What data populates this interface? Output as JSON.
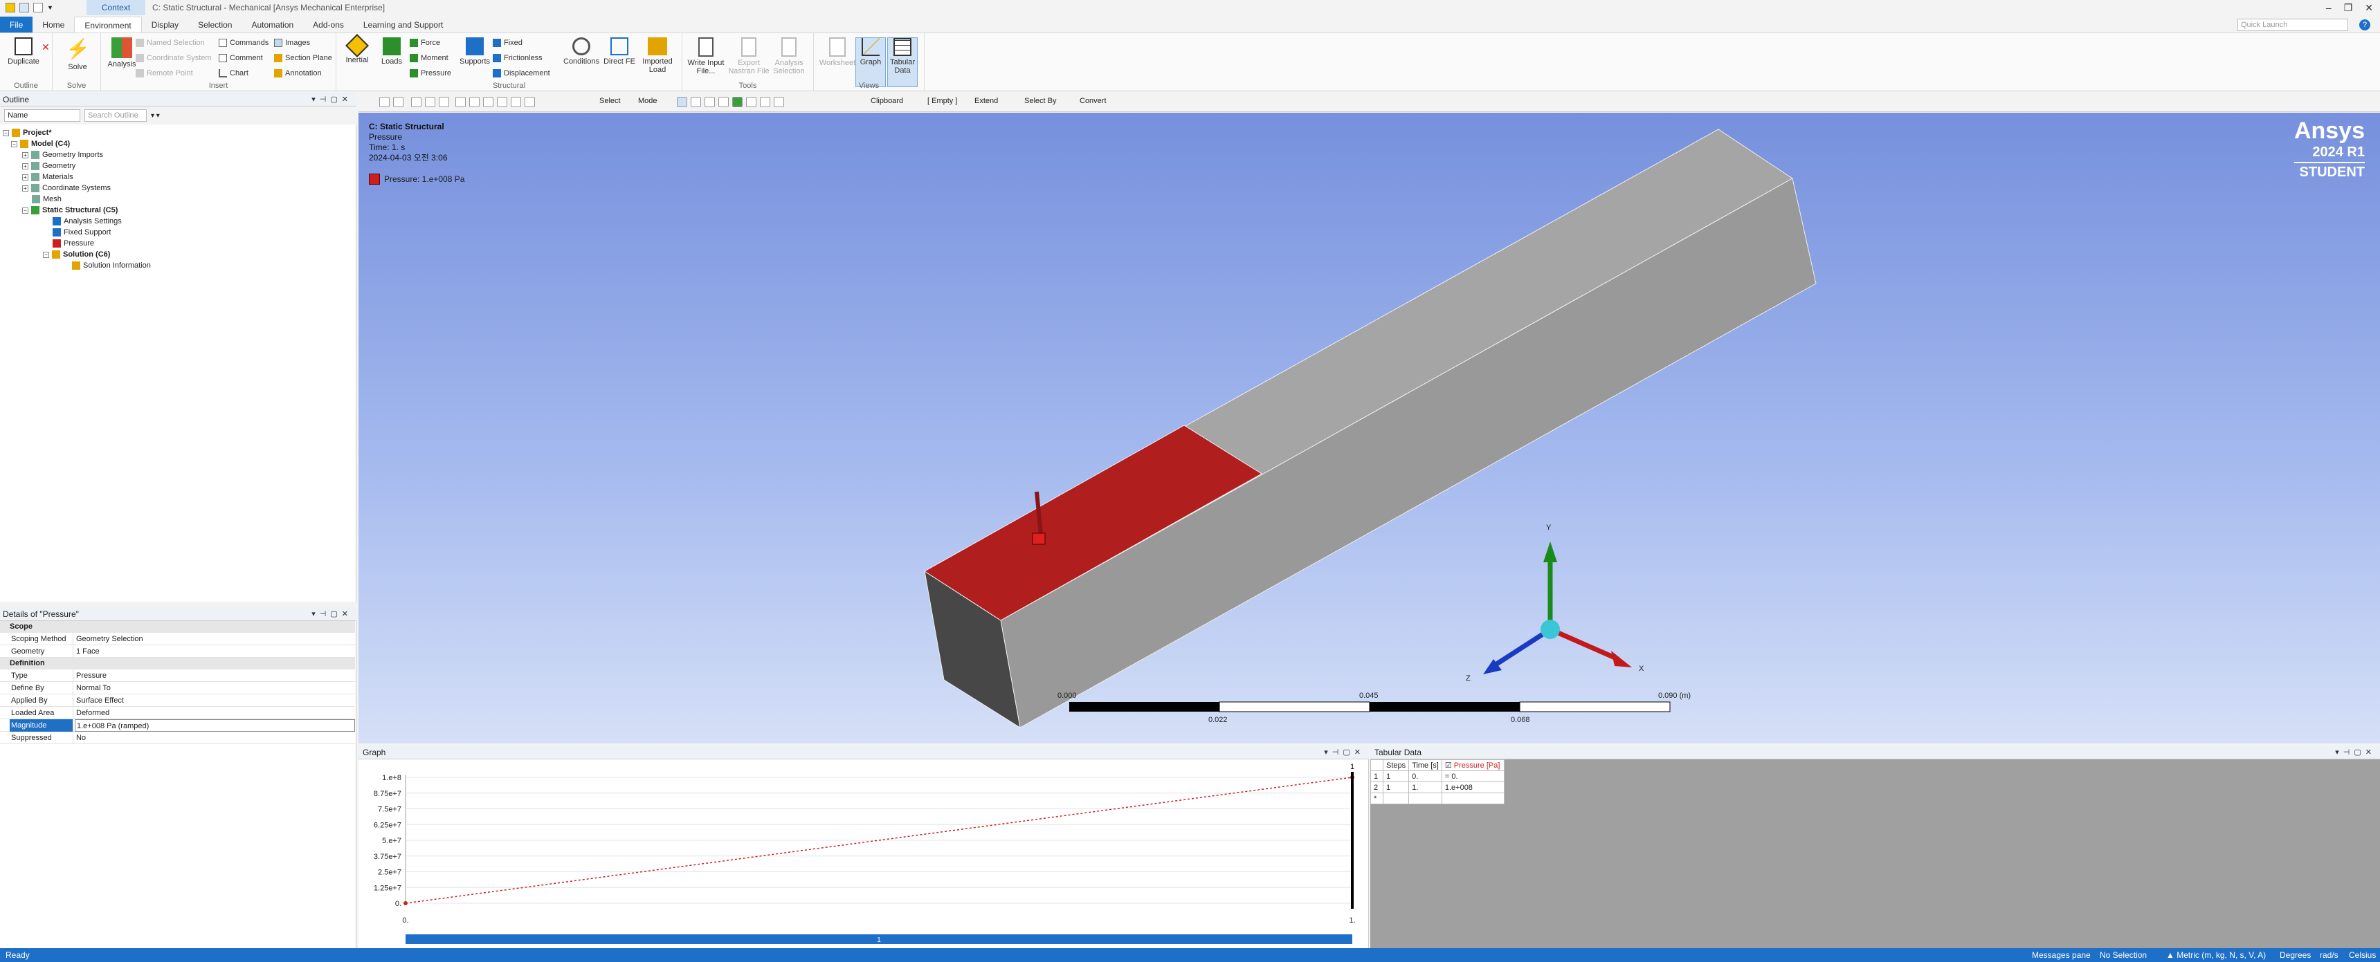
{
  "titlebar": {
    "context_tab": "Context",
    "doc_title": "C: Static Structural - Mechanical [Ansys Mechanical Enterprise]",
    "min": "–",
    "restore": "❐",
    "close": "✕"
  },
  "menu": {
    "tabs": [
      "File",
      "Home",
      "Environment",
      "Display",
      "Selection",
      "Automation",
      "Add-ons",
      "Learning and Support"
    ],
    "quick_launch_placeholder": "Quick Launch"
  },
  "ribbon": {
    "outline_group": {
      "duplicate": "Duplicate",
      "label": "Outline"
    },
    "solve_group": {
      "solve": "Solve",
      "label": "Solve"
    },
    "insert_group": {
      "analysis": "Analysis",
      "named_selection": "Named Selection",
      "coordinate_system": "Coordinate System",
      "remote_point": "Remote Point",
      "commands": "Commands",
      "comment": "Comment",
      "chart": "Chart",
      "images": "Images",
      "section_plane": "Section Plane",
      "annotation": "Annotation",
      "label": "Insert"
    },
    "structural_group": {
      "inertial": "Inertial",
      "loads": "Loads",
      "force": "Force",
      "moment": "Moment",
      "pressure": "Pressure",
      "supports": "Supports",
      "fixed": "Fixed",
      "frictionless": "Frictionless",
      "displacement": "Displacement",
      "conditions": "Conditions",
      "direct_fe": "Direct FE",
      "imported_load": "Imported Load",
      "label": "Structural"
    },
    "tools_group": {
      "write_input_file": "Write Input File...",
      "export_nastran": "Export Nastran File",
      "analysis_selection": "Analysis Selection",
      "label": "Tools"
    },
    "views_group": {
      "worksheet": "Worksheet",
      "graph": "Graph",
      "tabular_data": "Tabular Data",
      "label": "Views"
    }
  },
  "outline": {
    "title": "Outline",
    "filter_name": "Name",
    "search_placeholder": "Search Outline",
    "tree": [
      {
        "label": "Project*",
        "bold": true
      },
      {
        "label": "Model (C4)",
        "bold": true
      },
      {
        "label": "Geometry Imports"
      },
      {
        "label": "Geometry"
      },
      {
        "label": "Materials"
      },
      {
        "label": "Coordinate Systems"
      },
      {
        "label": "Mesh"
      },
      {
        "label": "Static Structural (C5)",
        "bold": true
      },
      {
        "label": "Analysis Settings"
      },
      {
        "label": "Fixed Support"
      },
      {
        "label": "Pressure"
      },
      {
        "label": "Solution (C6)",
        "bold": true
      },
      {
        "label": "Solution Information"
      }
    ]
  },
  "details": {
    "title": "Details of \"Pressure\"",
    "sections": {
      "scope": "Scope",
      "definition": "Definition"
    },
    "rows": {
      "scoping_method": [
        "Scoping Method",
        "Geometry Selection"
      ],
      "geometry": [
        "Geometry",
        "1 Face"
      ],
      "type": [
        "Type",
        "Pressure"
      ],
      "define_by": [
        "Define By",
        "Normal To"
      ],
      "applied_by": [
        "Applied By",
        "Surface Effect"
      ],
      "loaded_area": [
        "Loaded Area",
        "Deformed"
      ],
      "magnitude": [
        "Magnitude",
        "1.e+008 Pa  (ramped)"
      ],
      "suppressed": [
        "Suppressed",
        "No"
      ]
    }
  },
  "view_toolbar": {
    "select": "Select",
    "mode": "Mode",
    "clipboard": "Clipboard",
    "empty": "[ Empty ]",
    "extend": "Extend",
    "select_by": "Select By",
    "convert": "Convert"
  },
  "viewport": {
    "info_title": "C: Static Structural",
    "info_item": "Pressure",
    "info_time": "Time: 1. s",
    "info_date": "2024-04-03 오전 3:06",
    "legend": "Pressure: 1.e+008 Pa",
    "legend_color": "#cc1f1f",
    "scale_top": [
      "0.000",
      "0.045",
      "0.090 (m)"
    ],
    "scale_bottom": [
      "0.022",
      "0.068"
    ],
    "axes": {
      "x": "X",
      "y": "Y",
      "z": "Z"
    }
  },
  "brand": {
    "name": "Ansys",
    "version": "2024 R1",
    "edition": "STUDENT"
  },
  "graph": {
    "title": "Graph",
    "y_ticks": [
      "1.e+8",
      "8.75e+7",
      "7.5e+7",
      "6.25e+7",
      "5.e+7",
      "3.75e+7",
      "2.5e+7",
      "1.25e+7",
      "0."
    ],
    "x_labels": [
      "0.",
      "1."
    ],
    "marker": "1",
    "timeline_label": "1",
    "chart_data": {
      "type": "line",
      "x": [
        0,
        1
      ],
      "y": [
        0,
        100000000
      ],
      "ylim": [
        0,
        100000000
      ],
      "xlim": [
        0,
        1
      ]
    }
  },
  "tabular": {
    "title": "Tabular Data",
    "headers": [
      "Steps",
      "Time [s]",
      "Pressure [Pa]"
    ],
    "rows": [
      [
        "1",
        "1",
        "0.",
        "= 0."
      ],
      [
        "2",
        "1",
        "1.",
        "1.e+008"
      ],
      [
        "*",
        "",
        "",
        ""
      ]
    ]
  },
  "status": {
    "left": "Ready",
    "messages": "Messages pane",
    "selection": "No Selection",
    "units": "Metric (m, kg, N, s, V, A)",
    "degrees": "Degrees",
    "rads": "rad/s",
    "temp": "Celsius"
  }
}
